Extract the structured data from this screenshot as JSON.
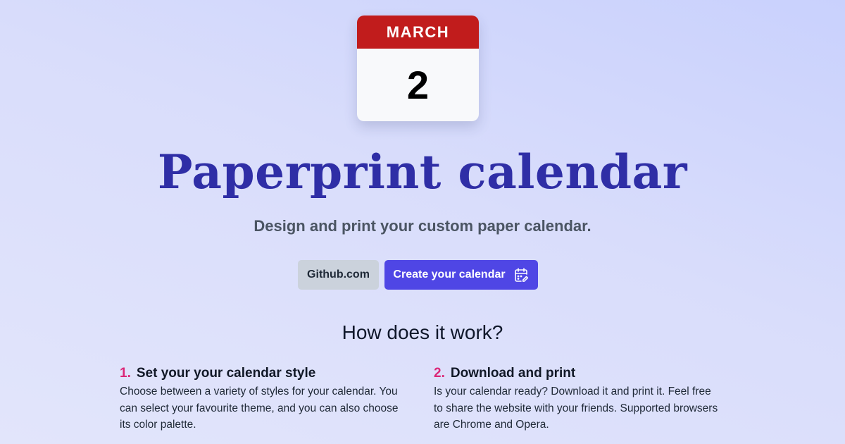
{
  "calendar_badge": {
    "month": "MARCH",
    "day": "2"
  },
  "hero": {
    "title": "Paperprint calendar",
    "subtitle": "Design and print your custom paper calendar."
  },
  "buttons": {
    "github_label": "Github.com",
    "create_label": "Create your calendar",
    "create_icon": "calendar-edit-icon"
  },
  "how_it_works": {
    "title": "How does it work?",
    "steps": [
      {
        "number": "1.",
        "heading": "Set your your calendar style",
        "text": "Choose between a variety of styles for your calendar. You can select your favourite theme, and you can also choose its color palette."
      },
      {
        "number": "2.",
        "heading": "Download and print",
        "text": "Is your calendar ready? Download it and print it. Feel free to share the website with your friends. Supported browsers are Chrome and Opera."
      }
    ]
  },
  "colors": {
    "title": "#2f2ea6",
    "calendar_header": "#c11c1c",
    "primary_button": "#4f46e5",
    "secondary_button": "#cbd2dc",
    "step_number": "#db2777"
  }
}
